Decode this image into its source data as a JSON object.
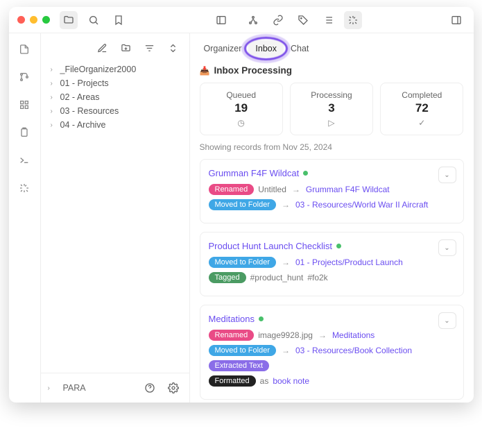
{
  "sidebar": {
    "items": [
      {
        "label": "_FileOrganizer2000"
      },
      {
        "label": "01 - Projects"
      },
      {
        "label": "02 - Areas"
      },
      {
        "label": "03 - Resources"
      },
      {
        "label": "04 - Archive"
      }
    ],
    "footer_label": "PARA"
  },
  "tabs": [
    {
      "label": "Organizer"
    },
    {
      "label": "Inbox"
    },
    {
      "label": "Chat"
    }
  ],
  "section_title": "Inbox Processing",
  "inbox_emoji": "📥",
  "stats": {
    "queued": {
      "label": "Queued",
      "value": "19",
      "icon": "clock"
    },
    "processing": {
      "label": "Processing",
      "value": "3",
      "icon": "play"
    },
    "completed": {
      "label": "Completed",
      "value": "72",
      "icon": "check"
    }
  },
  "showing_note": "Showing records from Nov 25, 2024",
  "cards": [
    {
      "title": "Grumman F4F Wildcat",
      "lines": [
        {
          "badge": "Renamed",
          "badge_color": "b-pink",
          "from": "Untitled",
          "to": "Grumman F4F Wildcat",
          "to_is_link": true
        },
        {
          "badge": "Moved to Folder",
          "badge_color": "b-blue",
          "to": "03 - Resources/World War II Aircraft",
          "to_is_link": true
        }
      ]
    },
    {
      "title": "Product Hunt Launch Checklist",
      "lines": [
        {
          "badge": "Moved to Folder",
          "badge_color": "b-blue",
          "to": "01 - Projects/Product Launch",
          "to_is_link": true
        },
        {
          "badge": "Tagged",
          "badge_color": "b-green",
          "tags": [
            "#product_hunt",
            "#fo2k"
          ]
        }
      ]
    },
    {
      "title": "Meditations",
      "lines": [
        {
          "badge": "Renamed",
          "badge_color": "b-pink",
          "from": "image9928.jpg",
          "to": "Meditations",
          "to_is_link": true
        },
        {
          "badge": "Moved to Folder",
          "badge_color": "b-blue",
          "to": "03 - Resources/Book Collection",
          "to_is_link": true
        },
        {
          "badge": "Extracted Text",
          "badge_color": "b-purple"
        },
        {
          "badge": "Formatted",
          "badge_color": "b-black",
          "as_label": "as",
          "to": "book note",
          "to_is_link": true
        }
      ]
    }
  ]
}
